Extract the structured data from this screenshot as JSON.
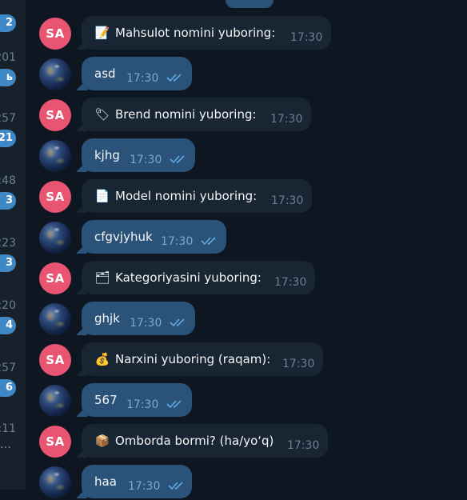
{
  "sidebar_edge": [
    {
      "time": "",
      "badge": "2"
    },
    {
      "time": "201",
      "badge": "ь"
    },
    {
      "time": "257",
      "badge": "21"
    },
    {
      "time": ":48",
      "badge": "3"
    },
    {
      "time": "223",
      "badge": "3"
    },
    {
      "time": ":20",
      "badge": "4"
    },
    {
      "time": "257",
      "badge": "6"
    },
    {
      "time": ":11",
      "badge": ""
    }
  ],
  "messages": [
    {
      "side": "in",
      "avatar_text": "SA",
      "icon": "memo-icon",
      "emoji": "📝",
      "text": "Mahsulot nomini yuboring:",
      "time": "17:30"
    },
    {
      "side": "out",
      "avatar_text": "",
      "icon": "",
      "emoji": "",
      "text": "asd",
      "time": "17:30",
      "read": true
    },
    {
      "side": "in",
      "avatar_text": "SA",
      "icon": "label-tag-icon",
      "emoji": "🏷",
      "text": "Brend nomini yuboring:",
      "time": "17:30"
    },
    {
      "side": "out",
      "avatar_text": "",
      "icon": "",
      "emoji": "",
      "text": "kjhg",
      "time": "17:30",
      "read": true
    },
    {
      "side": "in",
      "avatar_text": "SA",
      "icon": "page-icon",
      "emoji": "📄",
      "text": "Model nomini yuboring:",
      "time": "17:30"
    },
    {
      "side": "out",
      "avatar_text": "",
      "icon": "",
      "emoji": "",
      "text": "cfgvjyhuk",
      "time": "17:30",
      "read": true
    },
    {
      "side": "in",
      "avatar_text": "SA",
      "icon": "card-index-dividers-icon",
      "emoji": "🗂",
      "text": "Kategoriyasini yuboring:",
      "time": "17:30"
    },
    {
      "side": "out",
      "avatar_text": "",
      "icon": "",
      "emoji": "",
      "text": "ghjk",
      "time": "17:30",
      "read": true
    },
    {
      "side": "in",
      "avatar_text": "SA",
      "icon": "money-bag-icon",
      "emoji": "💰",
      "text": "Narxini yuboring (raqam):",
      "time": "17:30"
    },
    {
      "side": "out",
      "avatar_text": "",
      "icon": "",
      "emoji": "",
      "text": "567",
      "time": "17:30",
      "read": true
    },
    {
      "side": "in",
      "avatar_text": "SA",
      "icon": "package-icon",
      "emoji": "📦",
      "text": "Omborda bormi? (ha/yo‘q)",
      "time": "17:30"
    },
    {
      "side": "out",
      "avatar_text": "",
      "icon": "",
      "emoji": "",
      "text": "haa",
      "time": "17:30",
      "read": true
    }
  ],
  "colors": {
    "chat_bg": "#0e1621",
    "incoming_bubble": "#182533",
    "outgoing_bubble": "#2b5278",
    "avatar_sa": "#e95472",
    "badge": "#3e88c5",
    "read_ticks": "#5fa9e6"
  }
}
